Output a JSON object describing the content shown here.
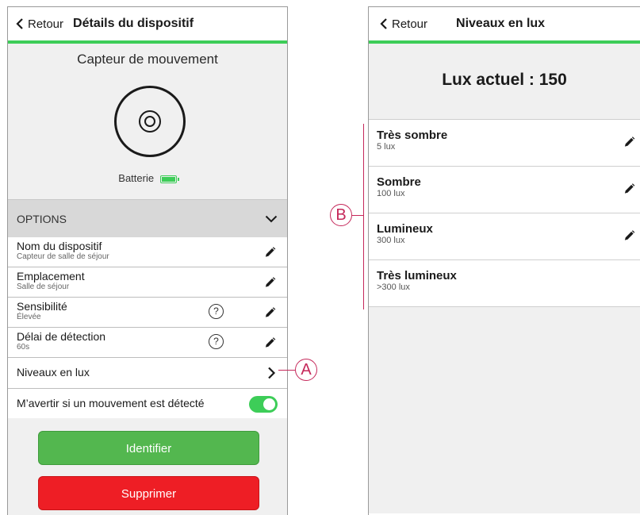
{
  "left_screen": {
    "back_label": "Retour",
    "title": "Détails du dispositif",
    "device_name": "Capteur de mouvement",
    "battery_label": "Batterie",
    "options_header": "OPTIONS",
    "rows": [
      {
        "label": "Nom du dispositif",
        "value": "Capteur de salle de séjour"
      },
      {
        "label": "Emplacement",
        "value": "Salle de séjour"
      },
      {
        "label": "Sensibilité",
        "value": "Élevée"
      },
      {
        "label": "Délai de détection",
        "value": "60s"
      },
      {
        "label": "Niveaux en lux"
      },
      {
        "label": "M’avertir si un mouvement est détecté"
      }
    ],
    "help_glyph": "?",
    "identify_label": "Identifier",
    "delete_label": "Supprimer"
  },
  "right_screen": {
    "back_label": "Retour",
    "title": "Niveaux en lux",
    "current_lux": "Lux actuel : 150",
    "levels": [
      {
        "name": "Très sombre",
        "value": "5 lux"
      },
      {
        "name": "Sombre",
        "value": "100 lux"
      },
      {
        "name": "Lumineux",
        "value": "300 lux"
      },
      {
        "name": "Très lumineux",
        "value": ">300 lux"
      }
    ]
  },
  "callouts": {
    "a": "A",
    "b": "B"
  },
  "colors": {
    "accent_green": "#3dcd58",
    "identify_green": "#53b74f",
    "delete_red": "#ee1e25",
    "callout": "#c5285a"
  },
  "icons": [
    "chevron-left-icon",
    "motion-sensor-icon",
    "battery-icon",
    "chevron-down-icon",
    "pencil-icon",
    "help-icon",
    "chevron-right-icon",
    "toggle-on"
  ]
}
